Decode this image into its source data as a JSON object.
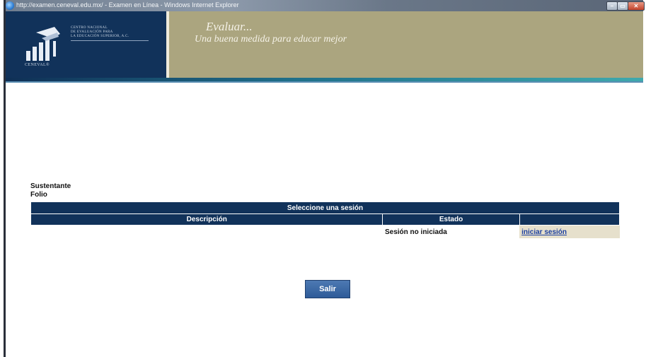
{
  "window": {
    "title": "http://examen.ceneval.edu.mx/ - Examen en Línea - Windows Internet Explorer",
    "icon": "internet-explorer-icon",
    "controls": {
      "minimize": "–",
      "maximize": "▭",
      "close": "✕"
    }
  },
  "header": {
    "logo_lines": [
      "CENTRO NACIONAL",
      "DE EVALUACIÓN PARA",
      "LA EDUCACIÓN SUPERIOR, A.C."
    ],
    "brand": "CENEVAL®",
    "slogan_title": "Evaluar...",
    "slogan_subtitle": "Una buena medida para educar mejor",
    "colors": {
      "logo_bg": "#11325a",
      "banner_bg": "#aba57f",
      "accent": "#3fa9ad"
    }
  },
  "candidate": {
    "sustentante_label": "Sustentante",
    "folio_label": "Folio"
  },
  "sessions": {
    "caption": "Seleccione una sesión",
    "columns": [
      "Descripción",
      "Estado",
      ""
    ],
    "rows": [
      {
        "description": "",
        "status": "Sesión no iniciada",
        "action": "iniciar sesión"
      }
    ]
  },
  "actions": {
    "exit_label": "Salir"
  }
}
